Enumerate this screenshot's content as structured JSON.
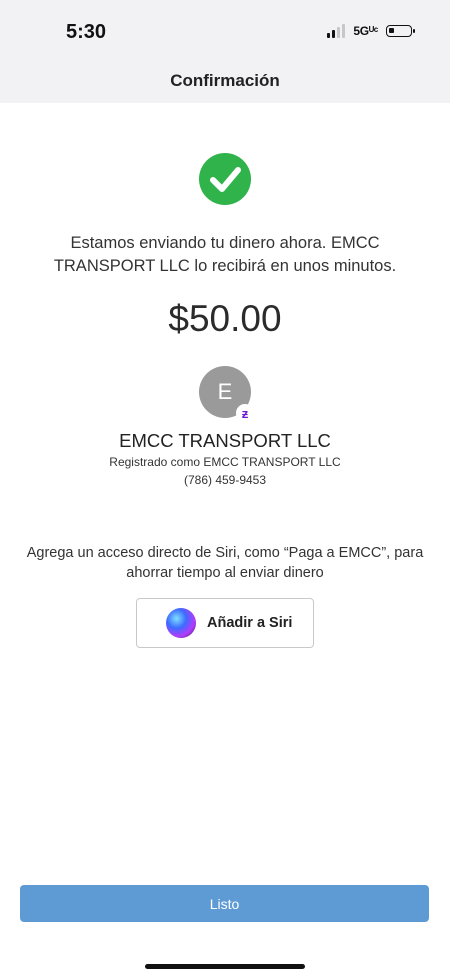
{
  "status_bar": {
    "time": "5:30",
    "network": "5Gᵁᶜ",
    "signal_bars": 4,
    "signal_active": 2,
    "battery_level": 0.25
  },
  "nav": {
    "title": "Confirmación"
  },
  "confirmation": {
    "icon": "check-circle-icon",
    "message": "Estamos enviando tu dinero ahora. EMCC TRANSPORT LLC lo recibirá en unos minutos.",
    "amount": "$50.00"
  },
  "recipient": {
    "initial": "E",
    "badge": "ƶ",
    "name": "EMCC TRANSPORT LLC",
    "registered": "Registrado como EMCC TRANSPORT LLC",
    "phone": "(786) 459-9453"
  },
  "siri": {
    "text": "Agrega un acceso directo de Siri, como “Paga a EMCC”, para ahorrar tiempo al enviar dinero",
    "button_label": "Añadir a Siri"
  },
  "footer": {
    "done_label": "Listo"
  },
  "colors": {
    "success": "#2fb34a",
    "primary_button": "#5e9bd5",
    "zelle": "#6d1ed4",
    "avatar": "#9a9a9a"
  }
}
